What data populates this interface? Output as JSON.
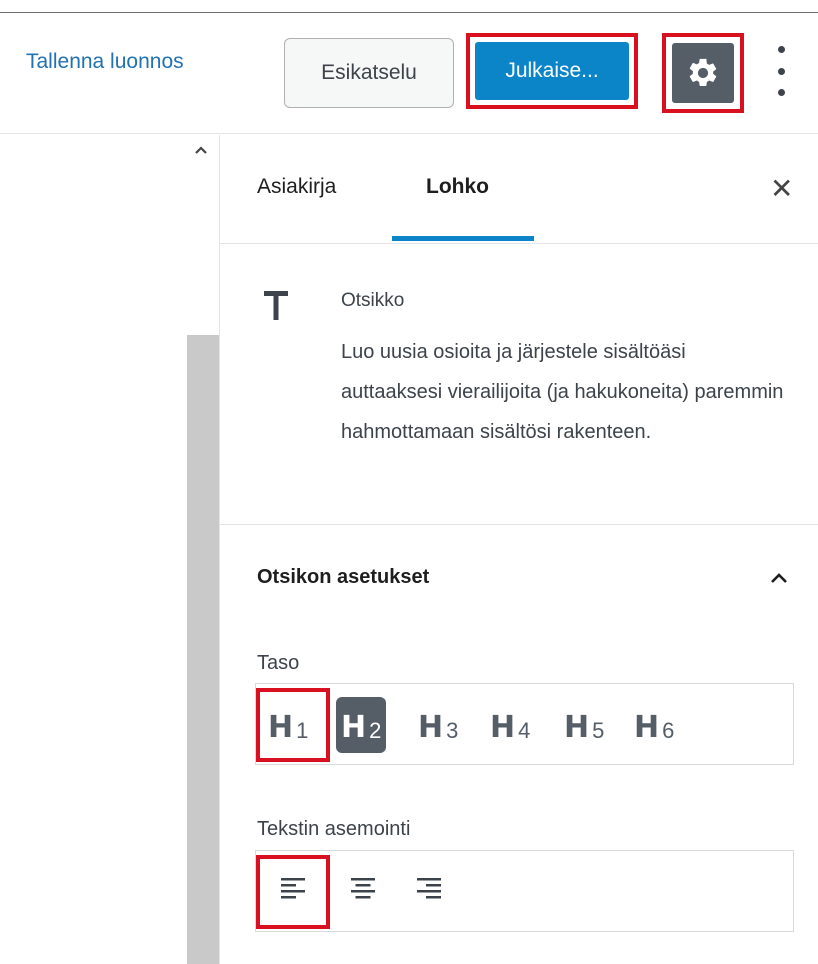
{
  "topbar": {
    "save_draft": "Tallenna luonnos",
    "preview": "Esikatselu",
    "publish": "Julkaise...",
    "settings_icon": "gear-icon",
    "more_icon": "more-vertical-icon"
  },
  "sidebar": {
    "tabs": [
      {
        "label": "Asiakirja",
        "active": false
      },
      {
        "label": "Lohko",
        "active": true
      }
    ],
    "close_icon": "close-icon",
    "block": {
      "icon": "heading-icon",
      "title": "Otsikko",
      "description": "Luo uusia osioita ja järjestele sisältöäsi auttaaksesi vierailijoita (ja hakukoneita) paremmin hahmottamaan sisältösi rakenteen."
    },
    "panel": {
      "title": "Otsikon asetukset",
      "chevron_icon": "chevron-up-icon",
      "level": {
        "label": "Taso",
        "options": [
          "1",
          "2",
          "3",
          "4",
          "5",
          "6"
        ],
        "letter": "H",
        "selected": "2"
      },
      "alignment": {
        "label": "Tekstin asemointi",
        "options": [
          "align-left-icon",
          "align-center-icon",
          "align-right-icon"
        ]
      }
    }
  },
  "colors": {
    "accent": "#0b85c8",
    "highlight_outline": "#d8101f",
    "dark_button": "#555d66",
    "link": "#2271b1"
  }
}
